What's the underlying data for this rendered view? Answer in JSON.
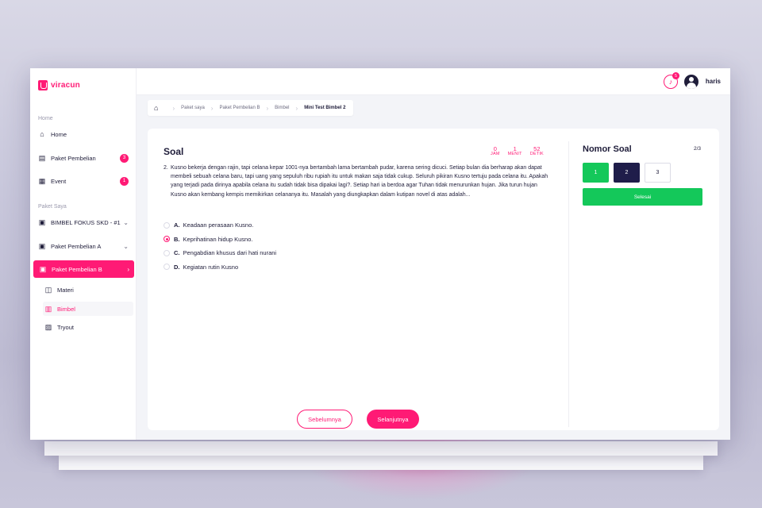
{
  "brand": {
    "name": "viracun"
  },
  "sidebar": {
    "section_home": "Home",
    "items": [
      {
        "label": "Home",
        "icon": "home-icon"
      },
      {
        "label": "Paket Pembelian",
        "icon": "store-icon",
        "badge": "3"
      },
      {
        "label": "Event",
        "icon": "calendar-icon",
        "badge": "1"
      }
    ],
    "section_paket": "Paket Saya",
    "paket_items": [
      {
        "label": "BIMBEL FOKUS SKD - #1",
        "icon": "package-icon"
      },
      {
        "label": "Paket Pembelian A",
        "icon": "package-icon"
      },
      {
        "label": "Paket Pembelian B",
        "icon": "package-icon",
        "active": true
      }
    ],
    "sub_items": [
      {
        "label": "Materi",
        "icon": "book-icon"
      },
      {
        "label": "Bimbel",
        "icon": "bimbel-icon",
        "active": true
      },
      {
        "label": "Tryout",
        "icon": "tryout-icon"
      }
    ]
  },
  "topbar": {
    "notification_count": "5",
    "username": "haris"
  },
  "breadcrumb": [
    "Paket saya",
    "Paket Pembelian B",
    "Bimbel",
    "Mini Test Bimbel 2"
  ],
  "question_panel": {
    "title": "Soal",
    "timer": {
      "hours": "0",
      "hours_label": "JAM",
      "minutes": "1",
      "minutes_label": "MENIT",
      "seconds": "52",
      "seconds_label": "DETIK"
    },
    "question_number": "2.",
    "question_text": "Kusno bekerja dengan rajin, tapi celana kepar 1001-nya bertambah lama bertambah pudar, karena sering dicuci. Setiap bulan dia berharap akan dapat membeli sebuah celana baru, tapi uang yang sepuluh ribu rupiah itu untuk makan saja tidak cukup. Seluruh pikiran Kusno tertuju pada celana itu. Apakah yang terjadi pada dirinya apabila celana itu sudah tidak bisa dipakai lagi?. Setiap hari ia berdoa agar Tuhan tidak menurunkan hujan. Jika turun hujan Kusno akan kembang kempis memikirkan celananya itu. Masalah yang diungkapkan dalam kutipan novel di atas adalah...",
    "options": [
      {
        "letter": "A.",
        "text": "Keadaan perasaan Kusno.",
        "selected": false
      },
      {
        "letter": "B.",
        "text": "Keprihatinan hidup Kusno.",
        "selected": true
      },
      {
        "letter": "C.",
        "text": "Pengabdian khusus dari hati nurani",
        "selected": false
      },
      {
        "letter": "D.",
        "text": "Kegiatan rutin Kusno",
        "selected": false
      }
    ],
    "prev_label": "Sebelumnya",
    "next_label": "Selanjutnya"
  },
  "nomor_panel": {
    "title": "Nomor Soal",
    "progress": "2/3",
    "numbers": [
      {
        "label": "1",
        "state": "answered"
      },
      {
        "label": "2",
        "state": "current"
      },
      {
        "label": "3",
        "state": "empty"
      }
    ],
    "finish_label": "Selesai"
  },
  "colors": {
    "accent": "#ff1a75",
    "success": "#14c85a",
    "navy": "#1f1d4a"
  }
}
